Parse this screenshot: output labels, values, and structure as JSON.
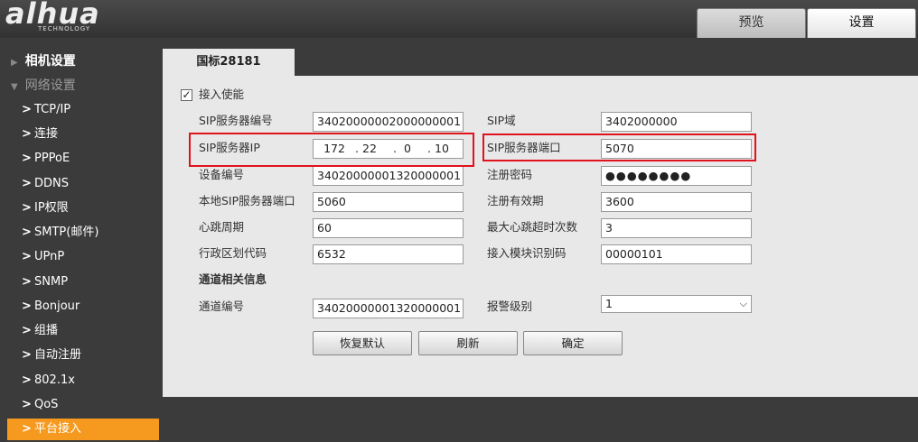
{
  "header": {
    "logo": "alhua",
    "logo_sub": "TECHNOLOGY",
    "tabs": {
      "preview": "预览",
      "settings": "设置"
    }
  },
  "sidebar": {
    "section_camera": "相机设置",
    "section_network": "网络设置",
    "items": [
      "TCP/IP",
      "连接",
      "PPPoE",
      "DDNS",
      "IP权限",
      "SMTP(邮件)",
      "UPnP",
      "SNMP",
      "Bonjour",
      "组播",
      "自动注册",
      "802.1x",
      "QoS",
      "平台接入"
    ],
    "active_item": "平台接入"
  },
  "panel": {
    "tab": "国标28181",
    "enable_label": "接入使能",
    "enable_checked": true,
    "fields": {
      "sip_server_id": {
        "label": "SIP服务器编号",
        "value": "34020000002000000001"
      },
      "sip_domain": {
        "label": "SIP域",
        "value": "3402000000"
      },
      "sip_server_ip": {
        "label": "SIP服务器IP",
        "octets": [
          "172",
          "22",
          "0",
          "10"
        ]
      },
      "sip_server_port": {
        "label": "SIP服务器端口",
        "value": "5070"
      },
      "device_id": {
        "label": "设备编号",
        "value": "34020000001320000001"
      },
      "reg_password": {
        "label": "注册密码",
        "value": "●●●●●●●●"
      },
      "local_sip_port": {
        "label": "本地SIP服务器端口",
        "value": "5060"
      },
      "reg_validity": {
        "label": "注册有效期",
        "value": "3600"
      },
      "heartbeat_period": {
        "label": "心跳周期",
        "value": "60"
      },
      "max_heartbeat_timeouts": {
        "label": "最大心跳超时次数",
        "value": "3"
      },
      "admin_region_code": {
        "label": "行政区划代码",
        "value": "6532"
      },
      "module_id_code": {
        "label": "接入模块识别码",
        "value": "00000101"
      }
    },
    "channel_section": "通道相关信息",
    "channel_id": {
      "label": "通道编号",
      "value": "34020000001320000001"
    },
    "alarm_level": {
      "label": "报警级别",
      "value": "1"
    },
    "buttons": {
      "restore": "恢复默认",
      "refresh": "刷新",
      "ok": "确定"
    }
  },
  "colors": {
    "accent": "#f59a1e",
    "highlight": "#e0121b",
    "panel_bg": "#e8e8e8",
    "chrome_bg": "#3b3b3b"
  }
}
